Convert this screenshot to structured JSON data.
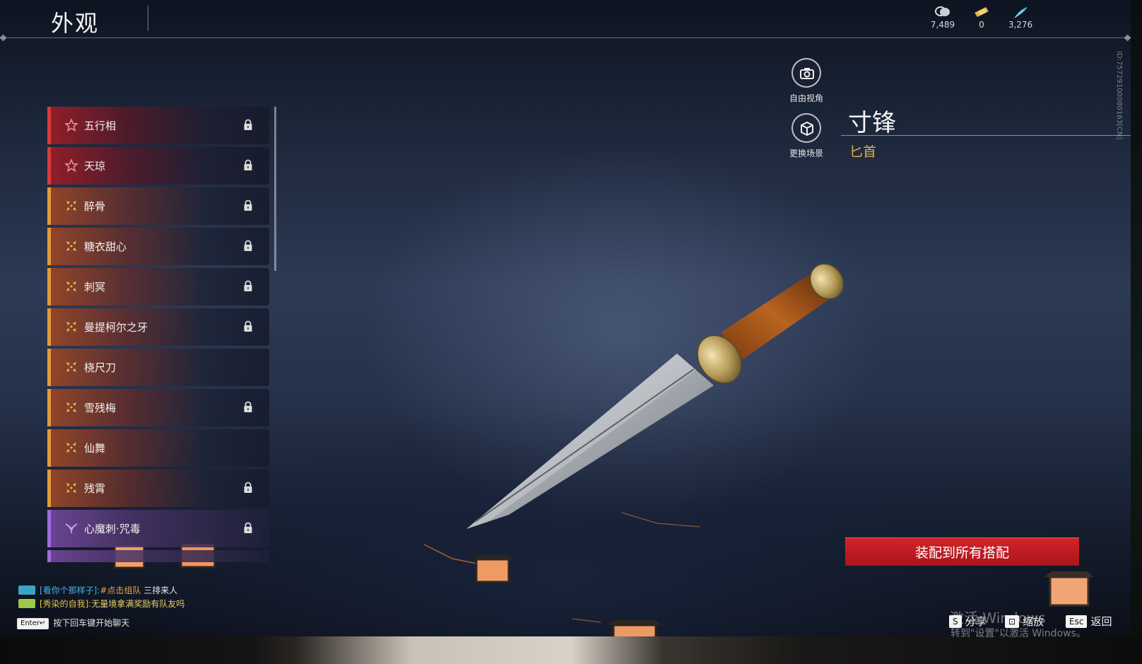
{
  "header": {
    "title": "外观",
    "currencies": [
      {
        "icon": "coin-stack-icon",
        "amount": "7,489"
      },
      {
        "icon": "ticket-icon",
        "amount": "0"
      },
      {
        "icon": "feather-icon",
        "amount": "3,276"
      }
    ]
  },
  "weapon_list": {
    "items": [
      {
        "name": "五行相",
        "rarity": "red",
        "icon": "star-outline-icon",
        "locked": true
      },
      {
        "name": "天琼",
        "rarity": "red",
        "icon": "star-outline-icon",
        "locked": true
      },
      {
        "name": "醉骨",
        "rarity": "gold",
        "icon": "four-petal-icon",
        "locked": true
      },
      {
        "name": "糖衣甜心",
        "rarity": "gold",
        "icon": "four-petal-icon",
        "locked": true
      },
      {
        "name": "刺冥",
        "rarity": "gold",
        "icon": "four-petal-icon",
        "locked": true
      },
      {
        "name": "曼提柯尔之牙",
        "rarity": "gold",
        "icon": "four-petal-icon",
        "locked": true
      },
      {
        "name": "桡尺刀",
        "rarity": "gold",
        "icon": "four-petal-icon",
        "locked": false
      },
      {
        "name": "雪残梅",
        "rarity": "gold",
        "icon": "four-petal-icon",
        "locked": true
      },
      {
        "name": "仙舞",
        "rarity": "gold",
        "icon": "four-petal-icon",
        "locked": false
      },
      {
        "name": "残霄",
        "rarity": "gold",
        "icon": "four-petal-icon",
        "locked": true
      },
      {
        "name": "心魔刺·咒毒",
        "rarity": "purple",
        "icon": "trident-icon",
        "locked": true
      }
    ]
  },
  "view_controls": {
    "free_camera_label": "自由视角",
    "change_scene_label": "更换场景"
  },
  "item": {
    "name": "寸锋",
    "type": "匕首",
    "user_id": "ID:7572910008016​3[CN]"
  },
  "equip_button_label": "装配到所有搭配",
  "chat": {
    "lines": [
      {
        "name": "[看你个那样子]:",
        "link": "#点击组队",
        "message": " 三排来人",
        "name_color": "blue"
      },
      {
        "name": "[秀染的自我]:",
        "link": "",
        "message": "无量境拿满奖励有队友吗",
        "name_color": "gold"
      }
    ],
    "enter_key": "Enter↵",
    "enter_hint": "按下回车键开始聊天"
  },
  "hints": [
    {
      "key": "S",
      "label": "分享"
    },
    {
      "key": "⊡",
      "label": "缩放"
    },
    {
      "key": "Esc",
      "label": "返回"
    }
  ],
  "watermark": {
    "line1": "激活 Windows",
    "line2": "转到\"设置\"以激活 Windows。"
  },
  "colors": {
    "accent_red": "#c91f25",
    "rarity_gold": "#e39a3b",
    "rarity_red": "#d63b3b",
    "rarity_purple": "#a06be0",
    "item_type": "#e7ad4c"
  }
}
